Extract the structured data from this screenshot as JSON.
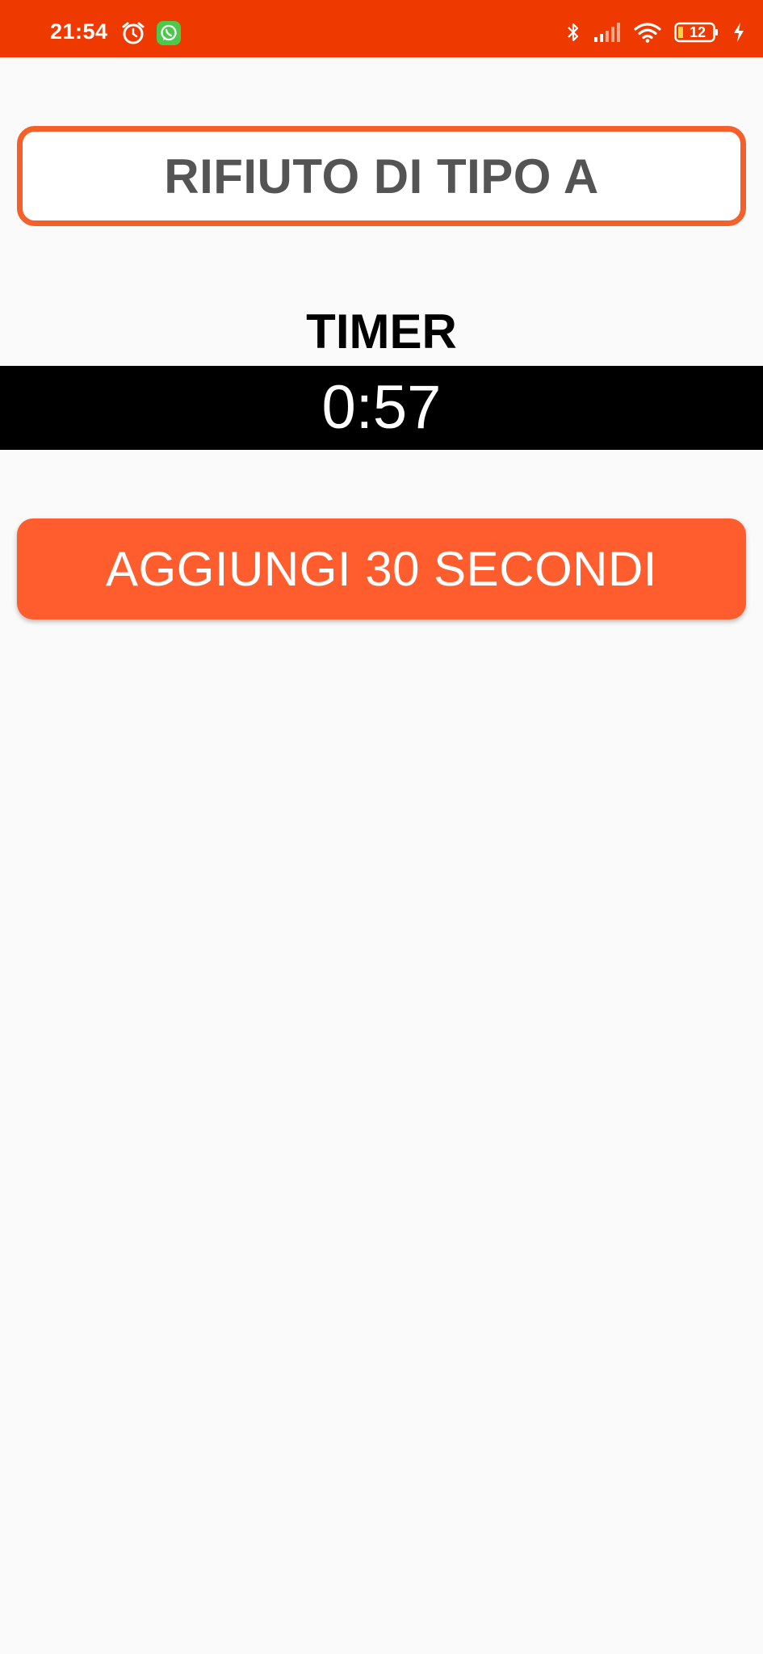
{
  "status_bar": {
    "time": "21:54",
    "battery_level": "12",
    "color": "#ee3a00",
    "icons_left": [
      "alarm-icon",
      "whatsapp-icon"
    ],
    "icons_right": [
      "bluetooth-icon",
      "signal-icon",
      "wifi-icon",
      "battery-icon",
      "charging-icon"
    ]
  },
  "card": {
    "title": "RIFIUTO DI TIPO A",
    "border_color": "#f45f2a"
  },
  "timer": {
    "label": "TIMER",
    "value": "0:57"
  },
  "actions": {
    "add_time_label": "AGGIUNGI 30 SECONDI",
    "button_color": "#ff5d2e"
  }
}
